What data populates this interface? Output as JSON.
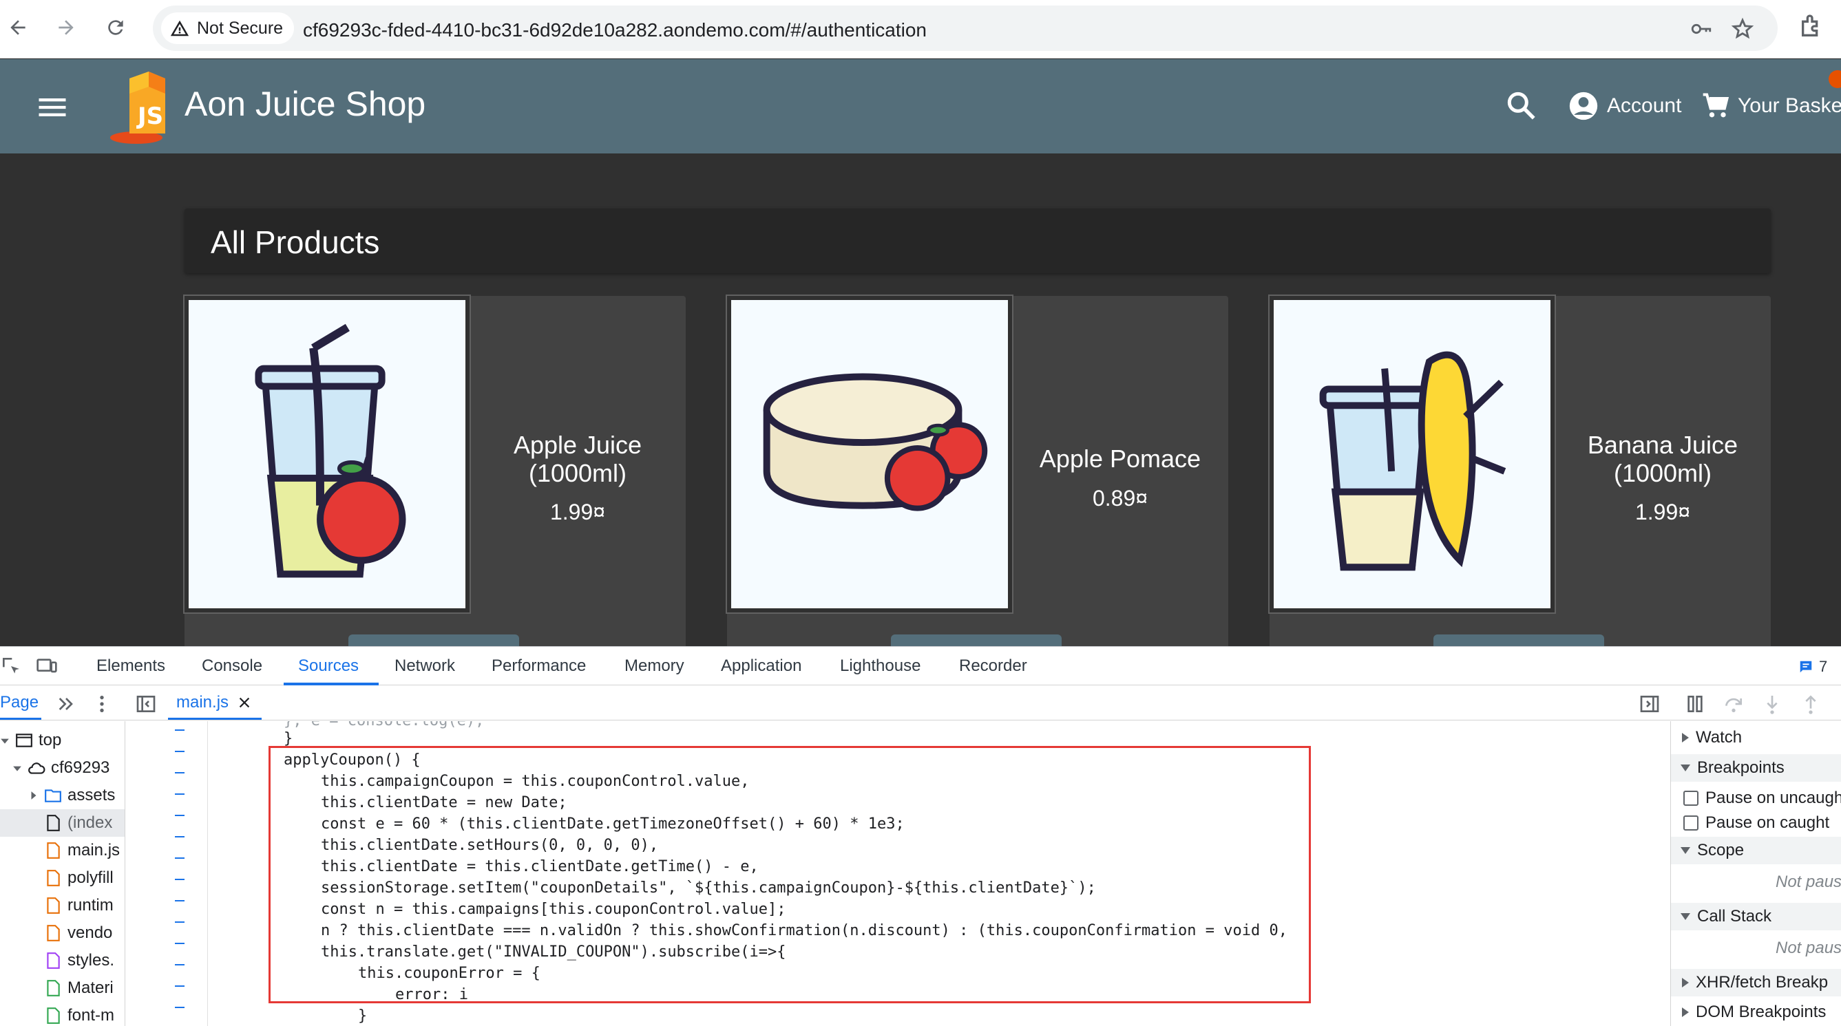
{
  "browser": {
    "security_label": "Not Secure",
    "url": "cf69293c-fded-4410-bc31-6d92de10a282.aondemo.com/#/authentication"
  },
  "app": {
    "title": "Aon Juice Shop",
    "logo_text": "JS",
    "account_label": "Account",
    "basket_label": "Your Baske"
  },
  "products": {
    "heading": "All Products",
    "items": [
      {
        "name": "Apple Juice (1000ml)",
        "price": "1.99¤"
      },
      {
        "name": "Apple Pomace",
        "price": "0.89¤"
      },
      {
        "name": "Banana Juice (1000ml)",
        "price": "1.99¤"
      }
    ]
  },
  "devtools": {
    "tabs": [
      "Elements",
      "Console",
      "Sources",
      "Network",
      "Performance",
      "Memory",
      "Application",
      "Lighthouse",
      "Recorder"
    ],
    "active_tab": "Sources",
    "issues_count": "7",
    "page_tab": "Page",
    "open_file": "main.js",
    "tree": [
      "top",
      "cf69293",
      "assets",
      "(index",
      "main.js",
      "polyfill",
      "runtim",
      "vendo",
      "styles.",
      "Materi",
      "font-m"
    ],
    "right_panel": {
      "watch": "Watch",
      "breakpoints": "Breakpoints",
      "pause_uncaught": "Pause on uncaught",
      "pause_caught": "Pause on caught",
      "scope": "Scope",
      "not_paused_1": "Not paus",
      "call_stack": "Call Stack",
      "not_paused_2": "Not paus",
      "xhr": "XHR/fetch Breakp",
      "dom": "DOM Breakpoints"
    },
    "code": {
      "line0": "}, e = console.log(e),",
      "line1": "}",
      "line2": "applyCoupon() {",
      "line3": "this.campaignCoupon = this.couponControl.value,",
      "line4": "this.clientDate = new Date;",
      "line5": "const e = 60 * (this.clientDate.getTimezoneOffset() + 60) * 1e3;",
      "line6": "this.clientDate.setHours(0, 0, 0, 0),",
      "line7": "this.clientDate = this.clientDate.getTime() - e,",
      "line8": "sessionStorage.setItem(\"couponDetails\", `${this.campaignCoupon}-${this.clientDate}`);",
      "line9": "const n = this.campaigns[this.couponControl.value];",
      "line10": "n ? this.clientDate === n.validOn ? this.showConfirmation(n.discount) : (this.couponConfirmation = void 0,",
      "line11": "this.translate.get(\"INVALID_COUPON\").subscribe(i=>{",
      "line12": "this.couponError = {",
      "line13": "error: i",
      "line14": "}"
    }
  }
}
